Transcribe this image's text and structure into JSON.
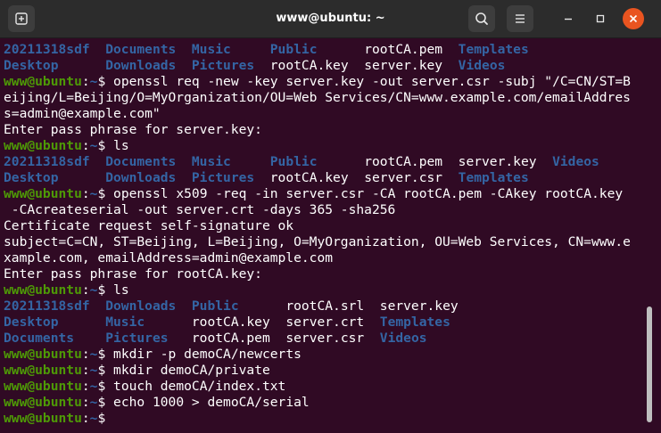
{
  "window": {
    "title": "www@ubuntu: ~"
  },
  "icons": {
    "new_tab": "new-tab-icon",
    "search": "search-icon",
    "menu": "hamburger-menu-icon",
    "minimize": "minimize-icon",
    "maximize": "maximize-icon",
    "close": "close-icon"
  },
  "colors": {
    "background": "#300a24",
    "prompt_user": "#4e9a06",
    "directory": "#3465a4",
    "close_button": "#e95420"
  },
  "prompt": {
    "user": "www@ubuntu",
    "sep": ":",
    "path": "~",
    "symbol": "$ "
  },
  "lines": [
    {
      "type": "ls",
      "tokens": [
        {
          "text": "20211318sdf",
          "kind": "dir"
        },
        {
          "text": "  ",
          "kind": "sp"
        },
        {
          "text": "Documents",
          "kind": "dir"
        },
        {
          "text": "  ",
          "kind": "sp"
        },
        {
          "text": "Music",
          "kind": "dir"
        },
        {
          "text": "     ",
          "kind": "sp"
        },
        {
          "text": "Public",
          "kind": "dir"
        },
        {
          "text": "      ",
          "kind": "sp"
        },
        {
          "text": "rootCA.pem",
          "kind": "file"
        },
        {
          "text": "  ",
          "kind": "sp"
        },
        {
          "text": "Templates",
          "kind": "dir"
        }
      ]
    },
    {
      "type": "ls",
      "tokens": [
        {
          "text": "Desktop",
          "kind": "dir"
        },
        {
          "text": "      ",
          "kind": "sp"
        },
        {
          "text": "Downloads",
          "kind": "dir"
        },
        {
          "text": "  ",
          "kind": "sp"
        },
        {
          "text": "Pictures",
          "kind": "dir"
        },
        {
          "text": "  ",
          "kind": "sp"
        },
        {
          "text": "rootCA.key",
          "kind": "file"
        },
        {
          "text": "  ",
          "kind": "sp"
        },
        {
          "text": "server.key",
          "kind": "file"
        },
        {
          "text": "  ",
          "kind": "sp"
        },
        {
          "text": "Videos",
          "kind": "dir"
        }
      ]
    },
    {
      "type": "prompt",
      "command": "openssl req -new -key server.key -out server.csr -subj \"/C=CN/ST=B"
    },
    {
      "type": "output",
      "text": "eijing/L=Beijing/O=MyOrganization/OU=Web Services/CN=www.example.com/emailAddres"
    },
    {
      "type": "output",
      "text": "s=admin@example.com\""
    },
    {
      "type": "output",
      "text": "Enter pass phrase for server.key:"
    },
    {
      "type": "prompt",
      "command": "ls"
    },
    {
      "type": "ls",
      "tokens": [
        {
          "text": "20211318sdf",
          "kind": "dir"
        },
        {
          "text": "  ",
          "kind": "sp"
        },
        {
          "text": "Documents",
          "kind": "dir"
        },
        {
          "text": "  ",
          "kind": "sp"
        },
        {
          "text": "Music",
          "kind": "dir"
        },
        {
          "text": "     ",
          "kind": "sp"
        },
        {
          "text": "Public",
          "kind": "dir"
        },
        {
          "text": "      ",
          "kind": "sp"
        },
        {
          "text": "rootCA.pem",
          "kind": "file"
        },
        {
          "text": "  ",
          "kind": "sp"
        },
        {
          "text": "server.key",
          "kind": "file"
        },
        {
          "text": "  ",
          "kind": "sp"
        },
        {
          "text": "Videos",
          "kind": "dir"
        }
      ]
    },
    {
      "type": "ls",
      "tokens": [
        {
          "text": "Desktop",
          "kind": "dir"
        },
        {
          "text": "      ",
          "kind": "sp"
        },
        {
          "text": "Downloads",
          "kind": "dir"
        },
        {
          "text": "  ",
          "kind": "sp"
        },
        {
          "text": "Pictures",
          "kind": "dir"
        },
        {
          "text": "  ",
          "kind": "sp"
        },
        {
          "text": "rootCA.key",
          "kind": "file"
        },
        {
          "text": "  ",
          "kind": "sp"
        },
        {
          "text": "server.csr",
          "kind": "file"
        },
        {
          "text": "  ",
          "kind": "sp"
        },
        {
          "text": "Templates",
          "kind": "dir"
        }
      ]
    },
    {
      "type": "prompt",
      "command": "openssl x509 -req -in server.csr -CA rootCA.pem -CAkey rootCA.key"
    },
    {
      "type": "output",
      "text": " -CAcreateserial -out server.crt -days 365 -sha256"
    },
    {
      "type": "output",
      "text": "Certificate request self-signature ok"
    },
    {
      "type": "output",
      "text": "subject=C=CN, ST=Beijing, L=Beijing, O=MyOrganization, OU=Web Services, CN=www.e"
    },
    {
      "type": "output",
      "text": "xample.com, emailAddress=admin@example.com"
    },
    {
      "type": "output",
      "text": "Enter pass phrase for rootCA.key:"
    },
    {
      "type": "prompt",
      "command": "ls"
    },
    {
      "type": "ls",
      "tokens": [
        {
          "text": "20211318sdf",
          "kind": "dir"
        },
        {
          "text": "  ",
          "kind": "sp"
        },
        {
          "text": "Downloads",
          "kind": "dir"
        },
        {
          "text": "  ",
          "kind": "sp"
        },
        {
          "text": "Public",
          "kind": "dir"
        },
        {
          "text": "      ",
          "kind": "sp"
        },
        {
          "text": "rootCA.srl",
          "kind": "file"
        },
        {
          "text": "  ",
          "kind": "sp"
        },
        {
          "text": "server.key",
          "kind": "file"
        }
      ]
    },
    {
      "type": "ls",
      "tokens": [
        {
          "text": "Desktop",
          "kind": "dir"
        },
        {
          "text": "      ",
          "kind": "sp"
        },
        {
          "text": "Music",
          "kind": "dir"
        },
        {
          "text": "      ",
          "kind": "sp"
        },
        {
          "text": "rootCA.key",
          "kind": "file"
        },
        {
          "text": "  ",
          "kind": "sp"
        },
        {
          "text": "server.crt",
          "kind": "file"
        },
        {
          "text": "  ",
          "kind": "sp"
        },
        {
          "text": "Templates",
          "kind": "dir"
        }
      ]
    },
    {
      "type": "ls",
      "tokens": [
        {
          "text": "Documents",
          "kind": "dir"
        },
        {
          "text": "    ",
          "kind": "sp"
        },
        {
          "text": "Pictures",
          "kind": "dir"
        },
        {
          "text": "   ",
          "kind": "sp"
        },
        {
          "text": "rootCA.pem",
          "kind": "file"
        },
        {
          "text": "  ",
          "kind": "sp"
        },
        {
          "text": "server.csr",
          "kind": "file"
        },
        {
          "text": "  ",
          "kind": "sp"
        },
        {
          "text": "Videos",
          "kind": "dir"
        }
      ]
    },
    {
      "type": "prompt",
      "command": "mkdir -p demoCA/newcerts"
    },
    {
      "type": "prompt",
      "command": "mkdir demoCA/private"
    },
    {
      "type": "prompt",
      "command": "touch demoCA/index.txt"
    },
    {
      "type": "prompt",
      "command": "echo 1000 > demoCA/serial"
    },
    {
      "type": "prompt",
      "command": ""
    }
  ]
}
